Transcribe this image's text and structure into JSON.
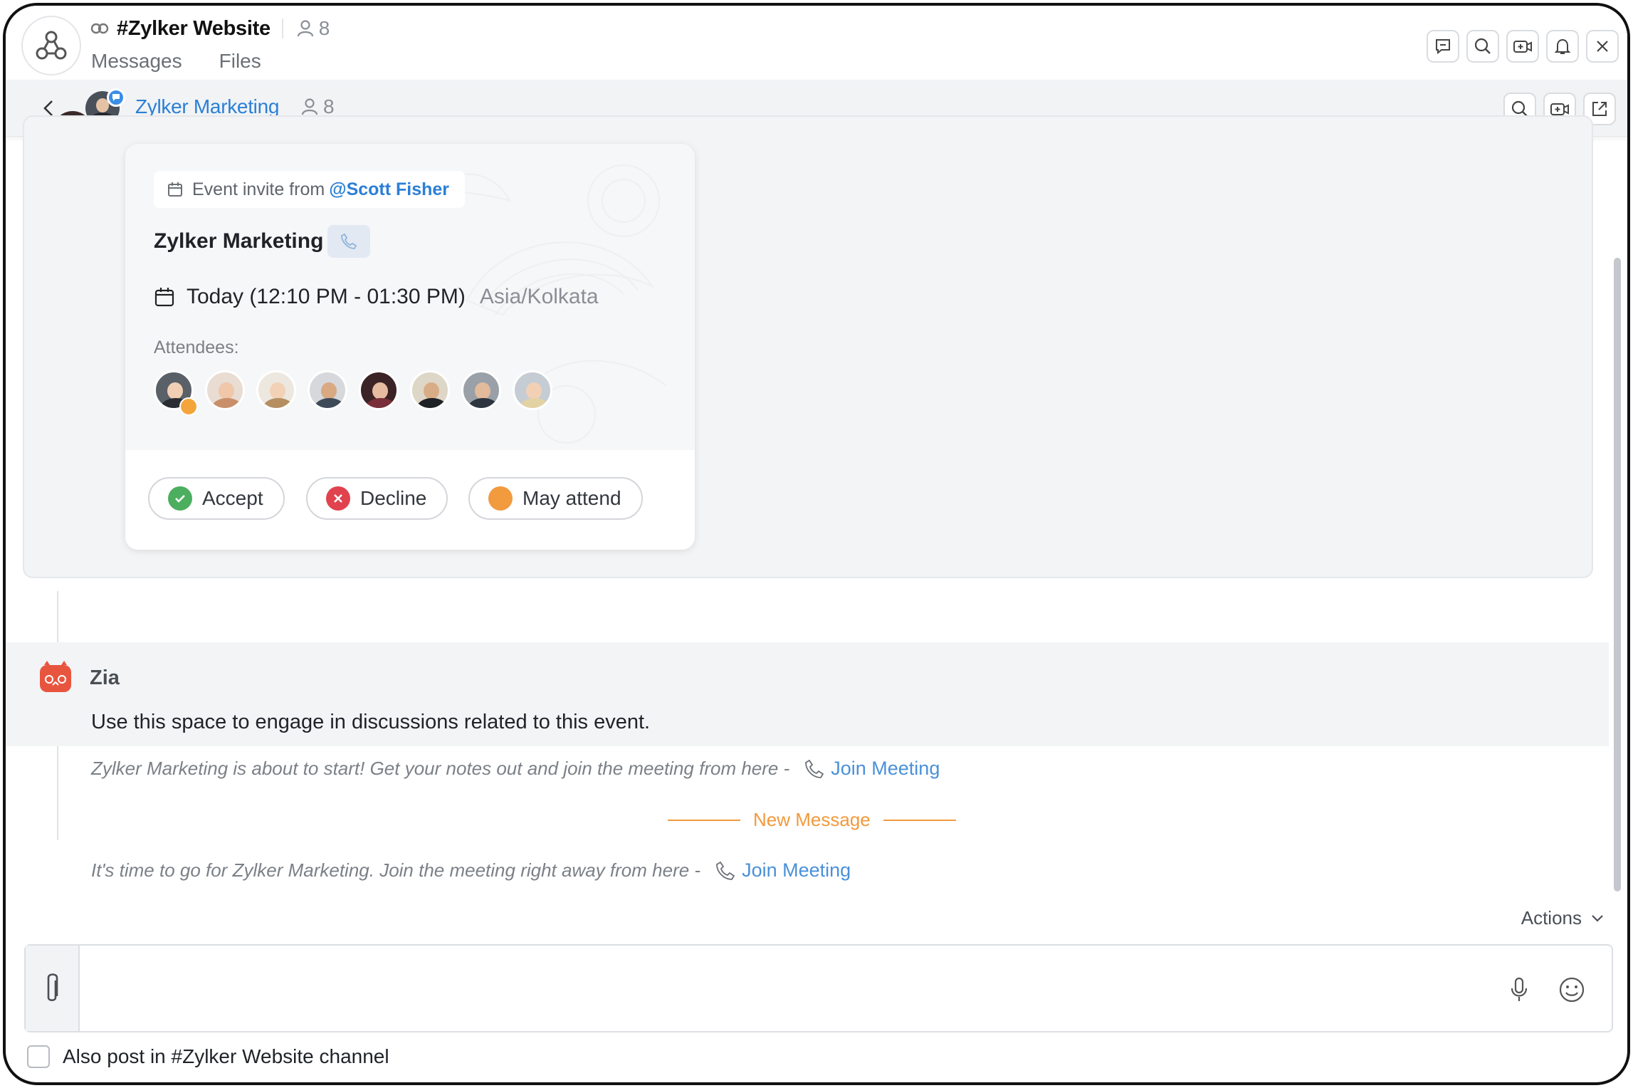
{
  "channel": {
    "title": "#Zylker Website",
    "member_count": "8",
    "tabs": [
      {
        "label": "Messages"
      },
      {
        "label": "Files"
      }
    ]
  },
  "header_actions": [
    "comment-icon",
    "search-icon",
    "video-add-icon",
    "bell-icon",
    "close-icon"
  ],
  "subchat": {
    "title": "Zylker Marketing",
    "member_count": "8"
  },
  "event": {
    "invite_text": "Event invite from",
    "invite_user": "@Scott Fisher",
    "title": "Zylker Marketing",
    "time": "Today (12:10 PM - 01:30 PM)",
    "timezone": "Asia/Kolkata",
    "attendees_label": "Attendees:",
    "attendee_count": 8,
    "actions": {
      "accept": "Accept",
      "decline": "Decline",
      "maybe": "May attend"
    }
  },
  "zia": {
    "name": "Zia",
    "message": "Use this space to engage in discussions related to this event."
  },
  "system_messages": [
    {
      "text": "Zylker Marketing is about to start! Get your notes out and join the meeting from here -",
      "link": "Join Meeting"
    },
    {
      "text": "It's time to go for Zylker Marketing. Join the meeting right away from here -",
      "link": "Join Meeting"
    }
  ],
  "new_message_label": "New Message",
  "actions_label": "Actions",
  "composer": {
    "placeholder": ""
  },
  "also_post_label": "Also post in #Zylker Website channel",
  "colors": {
    "link": "#2b7fd6",
    "accent": "#f19a3e",
    "accept": "#4cae5f",
    "decline": "#e0424e",
    "maybe": "#f19a3e"
  }
}
